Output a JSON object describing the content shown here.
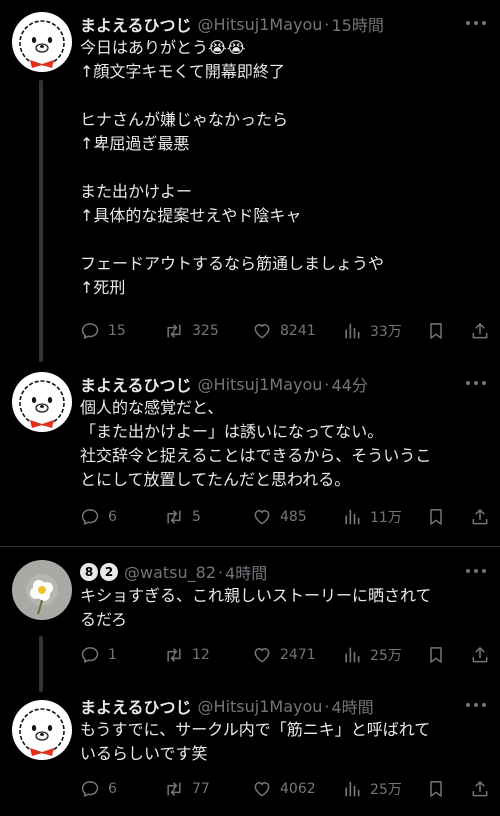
{
  "tweets": [
    {
      "name": "まよえるひつじ",
      "handle": "@Hitsuj1Mayou",
      "sep": "·",
      "time": "15時間",
      "lines": [
        "今日はありがとう😭😭",
        "↑顔文字キモくて開幕即終了",
        "",
        "ヒナさんが嫌じゃなかったら",
        "↑卑屈過ぎ最悪",
        "",
        "また出かけよー",
        "↑具体的な提案せえやド陰キャ",
        "",
        "フェードアウトするなら筋通しましょうや",
        "↑死刑"
      ],
      "replies": "15",
      "retweets": "325",
      "likes": "8241",
      "views": "33万"
    },
    {
      "name": "まよえるひつじ",
      "handle": "@Hitsuj1Mayou",
      "sep": "·",
      "time": "44分",
      "lines": [
        "個人的な感覚だと、",
        "「また出かけよー」は誘いになってない。",
        "社交辞令と捉えることはできるから、そういうこ",
        "とにして放置してたんだと思われる。"
      ],
      "replies": "6",
      "retweets": "5",
      "likes": "485",
      "views": "11万"
    },
    {
      "badge1": "8",
      "badge2": "2",
      "handle": "@watsu_82",
      "sep": "·",
      "time": "4時間",
      "lines": [
        "キショすぎる、これ親しいストーリーに晒されて",
        "るだろ"
      ],
      "replies": "1",
      "retweets": "12",
      "likes": "2471",
      "views": "25万"
    },
    {
      "name": "まよえるひつじ",
      "handle": "@Hitsuj1Mayou",
      "sep": "·",
      "time": "4時間",
      "lines": [
        "もうすでに、サークル内で「筋ニキ」と呼ばれて",
        "いるらしいです笑"
      ],
      "replies": "6",
      "retweets": "77",
      "likes": "4062",
      "views": "25万"
    }
  ],
  "icons": {
    "reply": "reply-icon",
    "retweet": "retweet-icon",
    "like": "heart-icon",
    "views": "views-icon",
    "bookmark": "bookmark-icon",
    "share": "share-icon",
    "more": "more-icon"
  },
  "colors": {
    "background": "#000000",
    "text": "#e7e9ea",
    "muted": "#71767b",
    "divider": "#2f3336"
  }
}
